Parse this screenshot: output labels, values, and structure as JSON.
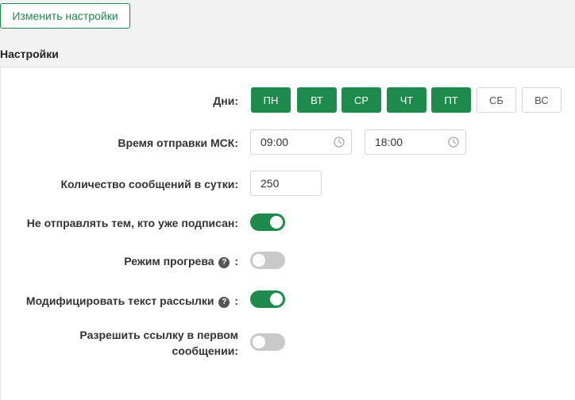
{
  "header": {
    "change_settings_label": "Изменить настройки",
    "section_title": "Настройки"
  },
  "days": {
    "label": "Дни:",
    "items": [
      {
        "label": "ПН",
        "active": true
      },
      {
        "label": "ВТ",
        "active": true
      },
      {
        "label": "СР",
        "active": true
      },
      {
        "label": "ЧТ",
        "active": true
      },
      {
        "label": "ПТ",
        "active": true
      },
      {
        "label": "СБ",
        "active": false
      },
      {
        "label": "ВС",
        "active": false
      }
    ]
  },
  "send_time": {
    "label": "Время отправки МСК:",
    "from_value": "09:00",
    "to_value": "18:00"
  },
  "messages_per_day": {
    "label": "Количество сообщений в сутки:",
    "value": "250"
  },
  "toggles": {
    "skip_subscribed": {
      "label": "Не отправлять тем, кто уже подписан:",
      "enabled": true
    },
    "warmup_mode": {
      "label": "Режим прогрева",
      "suffix": ":",
      "enabled": false
    },
    "modify_text": {
      "label": "Модифицировать текст рассылки",
      "suffix": ":",
      "enabled": true
    },
    "allow_link": {
      "label": "Разрешить ссылку в первом сообщении:",
      "enabled": false
    }
  },
  "help_glyph": "?",
  "colors": {
    "accent": "#1e8a4c",
    "toggle_off": "#c9c9c9"
  }
}
